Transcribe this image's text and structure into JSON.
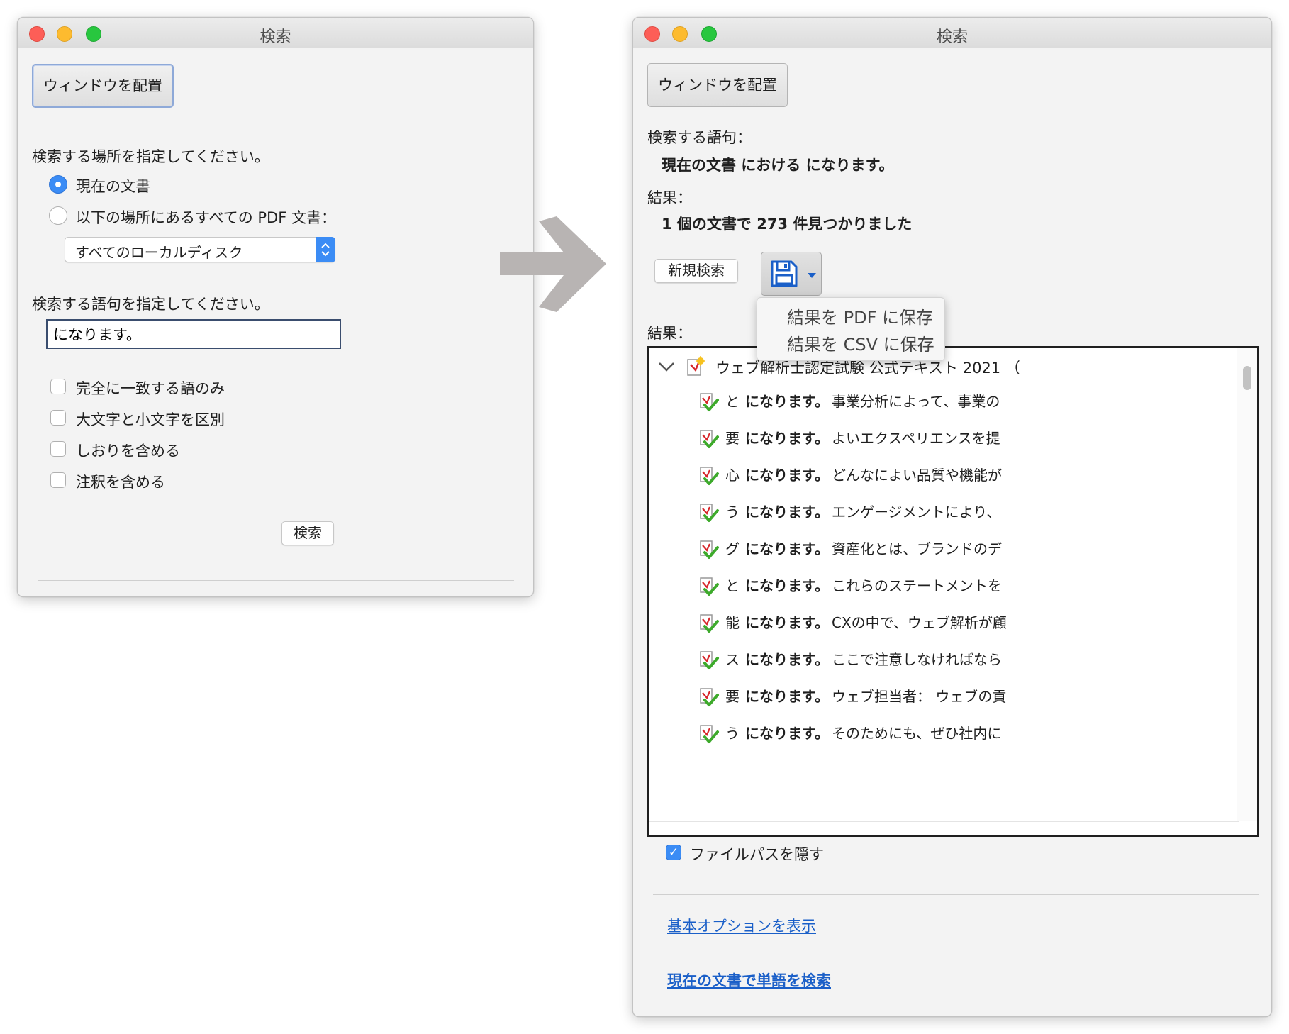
{
  "left": {
    "title": "検索",
    "arrange_button": "ウィンドウを配置",
    "location_prompt": "検索する場所を指定してください。",
    "radio_current": "現在の文書",
    "radio_all_pdfs": "以下の場所にあるすべての PDF 文書：",
    "location_select": "すべてのローカルディスク",
    "term_prompt": "検索する語句を指定してください。",
    "search_value": "になります。",
    "options": [
      "完全に一致する語のみ",
      "大文字と小文字を区別",
      "しおりを含める",
      "注釈を含める"
    ],
    "search_button": "検索"
  },
  "right": {
    "title": "検索",
    "arrange_button": "ウィンドウを配置",
    "query_label": "検索する語句：",
    "query_text": "現在の文書 における になります。",
    "results_label": "結果：",
    "results_summary": "1 個の文書で 273 件見つかりました",
    "new_search_button": "新規検索",
    "save_menu": [
      "結果を PDF に保存",
      "結果を CSV に保存"
    ],
    "results_list_label": "結果：",
    "doc_title": "ウェブ解析士認定試験 公式テキスト 2021 （",
    "results": [
      {
        "pre": "と",
        "hit": "になります。",
        "post": "事業分析によって、事業の"
      },
      {
        "pre": "要",
        "hit": "になります。",
        "post": "よいエクスペリエンスを提"
      },
      {
        "pre": "心",
        "hit": "になります。",
        "post": "どんなによい品質や機能が"
      },
      {
        "pre": "う",
        "hit": "になります。",
        "post": "エンゲージメントにより、"
      },
      {
        "pre": "グ",
        "hit": "になります。",
        "post": "資産化とは、ブランドのデ"
      },
      {
        "pre": "と",
        "hit": "になります。",
        "post": "これらのステートメントを"
      },
      {
        "pre": "能",
        "hit": "になります。",
        "post": "CXの中で、ウェブ解析が顧"
      },
      {
        "pre": "ス",
        "hit": "になります。",
        "post": "ここで注意しなければなら"
      },
      {
        "pre": "要",
        "hit": "になります。",
        "post": "ウェブ担当者： ウェブの貢"
      },
      {
        "pre": "う",
        "hit": "になります。",
        "post": "そのためにも、ぜひ社内に"
      }
    ],
    "hide_path_label": "ファイルパスを隠す",
    "basic_options_link": "基本オプションを表示",
    "word_search_link": "現在の文書で単語を検索"
  },
  "colors": {
    "accent": "#3b8cf5",
    "link": "#1a5fc8",
    "arrow": "#b8b4b3"
  }
}
